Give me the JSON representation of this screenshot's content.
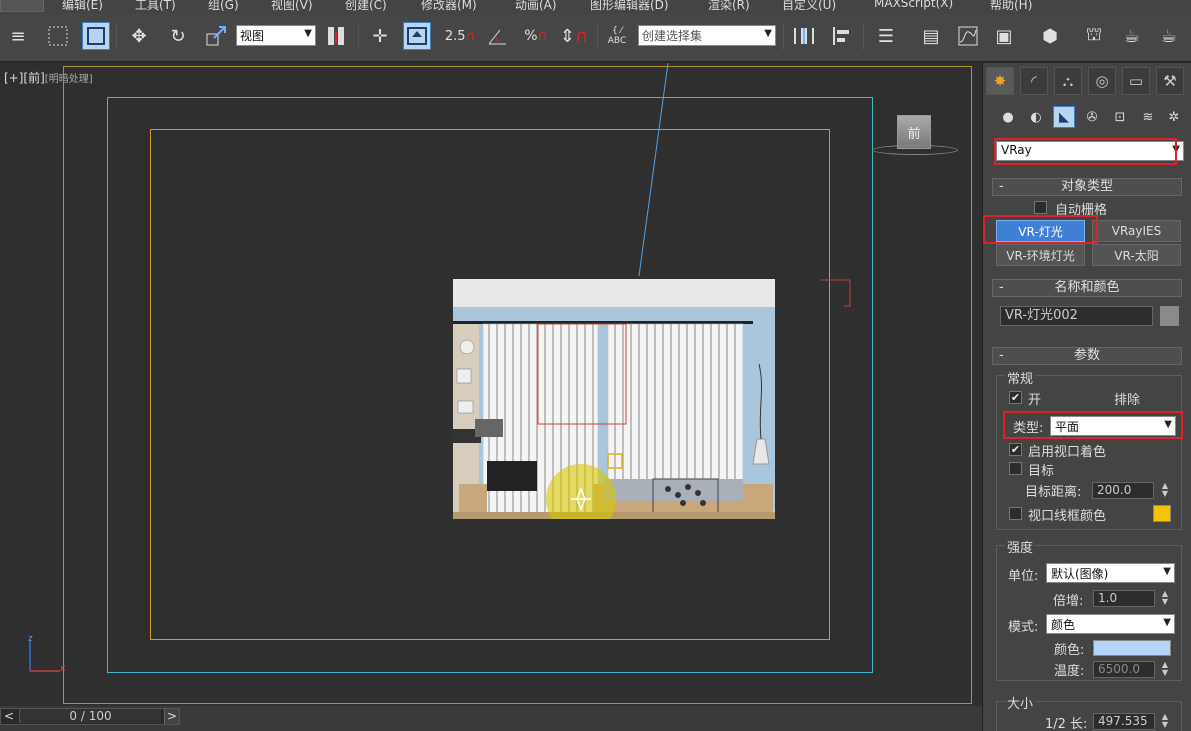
{
  "menubar": {
    "items": [
      "编辑(E)",
      "工具(T)",
      "组(G)",
      "视图(V)",
      "创建(C)",
      "修改器(M)",
      "动画(A)",
      "图形编辑器(D)",
      "渲染(R)",
      "自定义(U)",
      "MAXScript(X)",
      "帮助(H)"
    ]
  },
  "toolbar": {
    "view_select": "视图",
    "snap_label": "2.5",
    "selection_set_placeholder": "创建选择集",
    "abc_label": "ABC"
  },
  "viewport": {
    "label_plus": "[+]",
    "label_view": "[前]",
    "label_shading": "[明暗处理]",
    "viewcube_label": "前",
    "axis_z": "z",
    "axis_x": "x"
  },
  "timeline": {
    "value": "0 / 100",
    "prev": "<",
    "next": ">"
  },
  "panel": {
    "category_dropdown": "VRay",
    "object_type": {
      "title": "对象类型",
      "autogrid_label": "自动栅格",
      "buttons": [
        "VR-灯光",
        "VRayIES",
        "VR-环境灯光",
        "VR-太阳"
      ]
    },
    "name_color": {
      "title": "名称和颜色",
      "name_value": "VR-灯光002",
      "color": "#8a8a8a"
    },
    "params": {
      "title": "参数",
      "general_label": "常规",
      "on_label": "开",
      "on_checked": true,
      "exclude_label": "排除",
      "type_label": "类型:",
      "type_value": "平面",
      "viewport_shading_label": "启用视口着色",
      "viewport_shading_checked": true,
      "target_label": "目标",
      "target_checked": false,
      "target_dist_label": "目标距离:",
      "target_dist_value": "200.0",
      "wire_color_label": "视口线框颜色",
      "wire_color_checked": false,
      "wire_color": "#f5c400"
    },
    "intensity": {
      "title": "强度",
      "unit_label": "单位:",
      "unit_value": "默认(图像)",
      "multiplier_label": "倍增:",
      "multiplier_value": "1.0",
      "mode_label": "模式:",
      "mode_value": "颜色",
      "color_label": "颜色:",
      "color": "#b4d4f8",
      "temperature_label": "温度:",
      "temperature_value": "6500.0"
    },
    "size": {
      "title": "大小",
      "half_length_label": "1/2 长:",
      "half_length_value": "497.535"
    }
  },
  "colors": {
    "frame_yellow": "#a8962f",
    "frame_cyan": "#3fb6c8",
    "frame_orange": "#d7962a",
    "highlight_red": "#e0202a",
    "active_blue": "#3f7fd4"
  }
}
